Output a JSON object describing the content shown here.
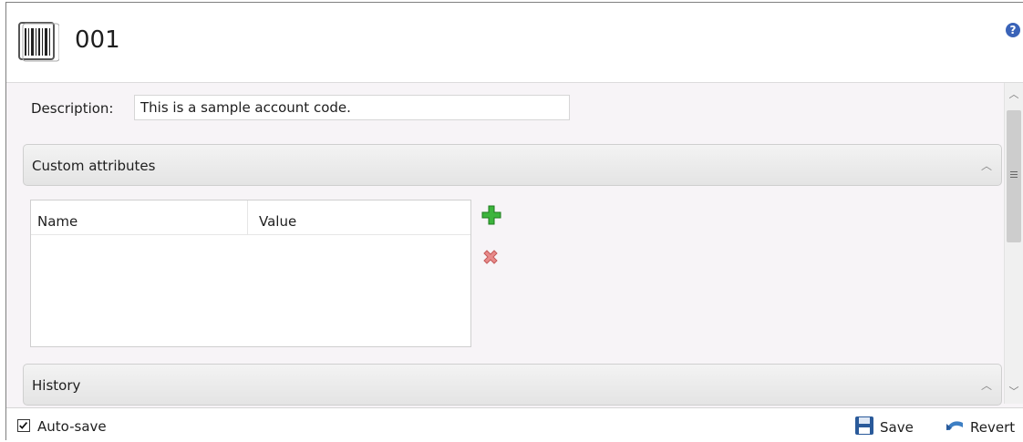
{
  "header": {
    "title": "001",
    "help_glyph": "?"
  },
  "description": {
    "label": "Description:",
    "value": "This is a sample account code."
  },
  "custom_attributes": {
    "label": "Custom attributes",
    "columns": [
      "Name",
      "Value"
    ]
  },
  "history": {
    "label": "History"
  },
  "footer": {
    "auto_save_label": "Auto-save",
    "auto_save_checked": true,
    "save_label": "Save",
    "revert_label": "Revert"
  },
  "icons": [
    "barcode-icon",
    "help-icon",
    "add-icon",
    "remove-icon",
    "chevron-up-icon",
    "save-icon",
    "revert-icon",
    "checkmark-icon"
  ],
  "colors": {
    "add": "#2fa82f",
    "remove": "#e07b7b",
    "help": "#3a63b8",
    "save": "#2a5a9a"
  }
}
